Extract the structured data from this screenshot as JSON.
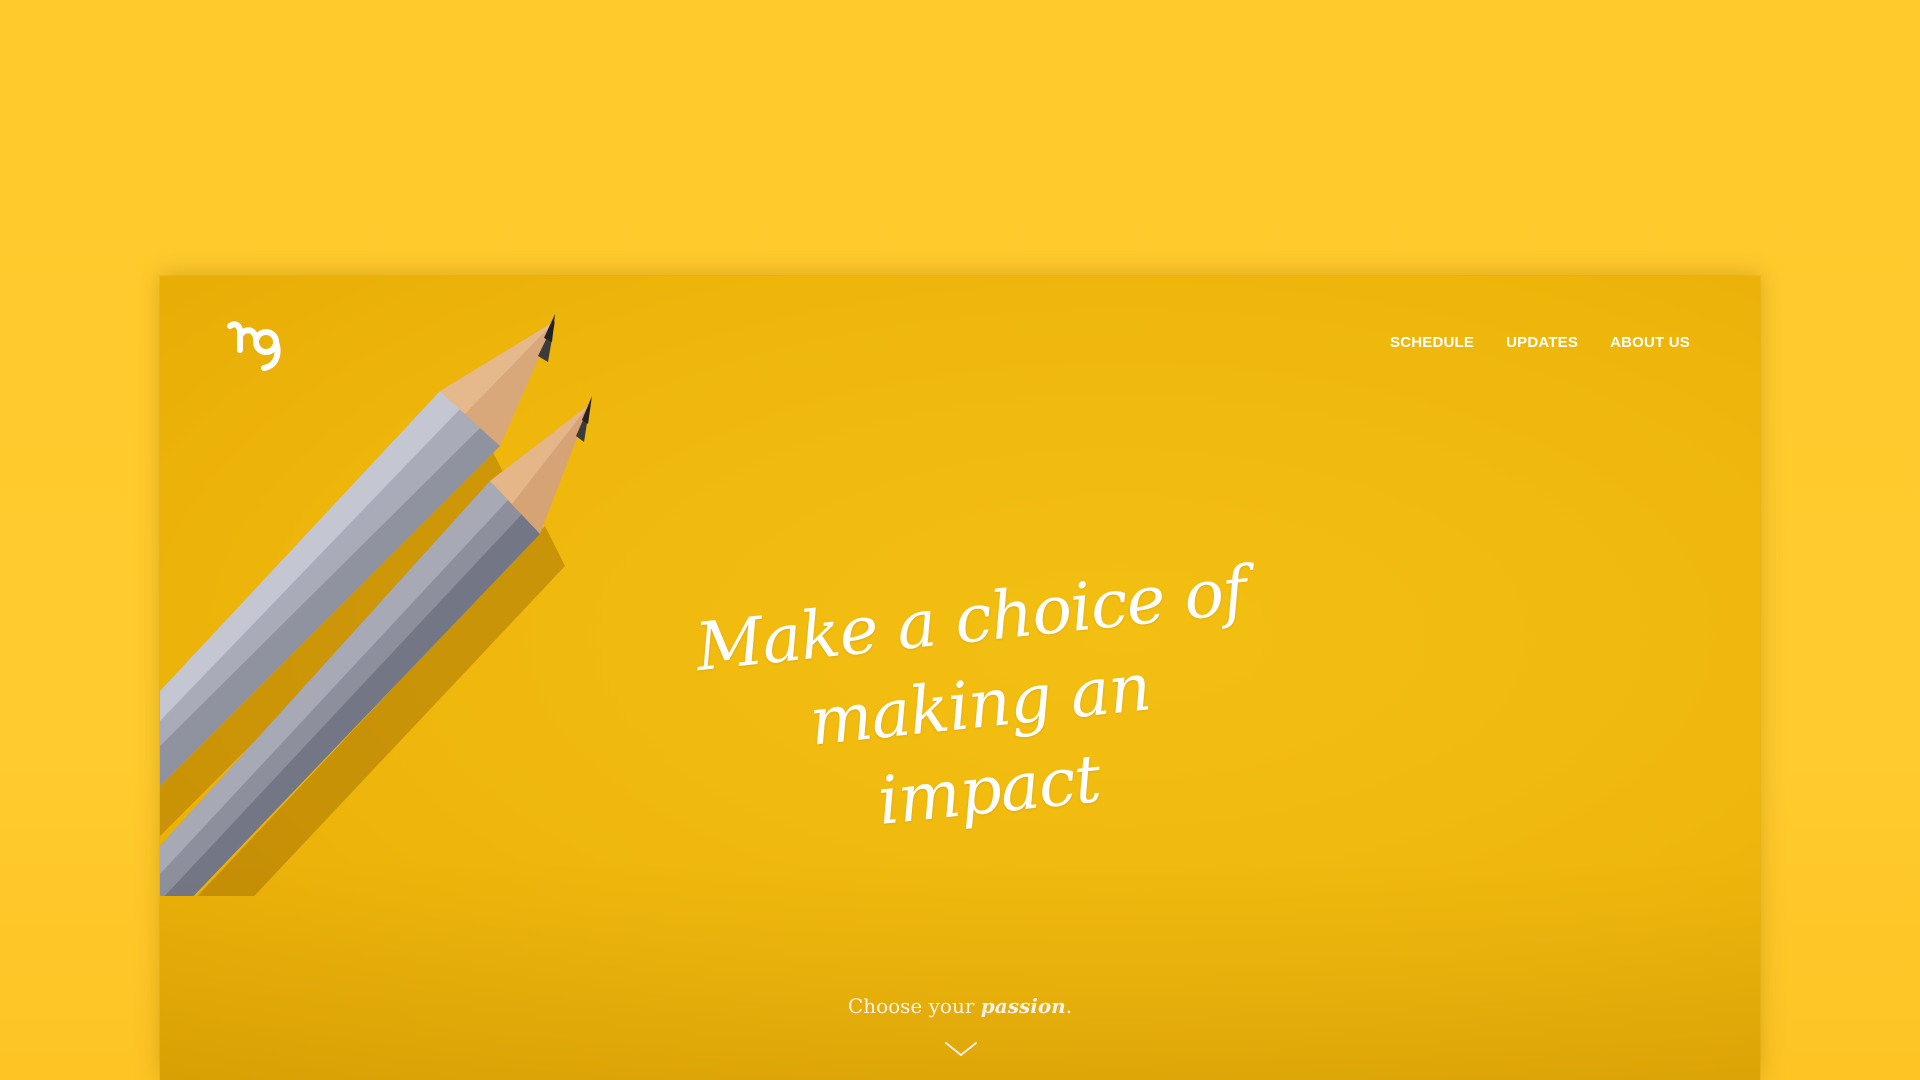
{
  "brand": {
    "logo_icon": "ng-monogram-logo"
  },
  "nav": {
    "items": [
      {
        "label": "SCHEDULE"
      },
      {
        "label": "UPDATES"
      },
      {
        "label": "ABOUT US"
      }
    ]
  },
  "hero": {
    "headline_line1": "Make a choice of making an",
    "headline_line2": "impact",
    "tagline_prefix": "Choose your",
    "tagline_emphasis": "passion",
    "tagline_suffix": ".",
    "scroll_icon": "chevron-down-icon"
  },
  "colors": {
    "page_background": "#ffca2c",
    "hero_background": "#efb70c",
    "text": "#ffffff"
  }
}
